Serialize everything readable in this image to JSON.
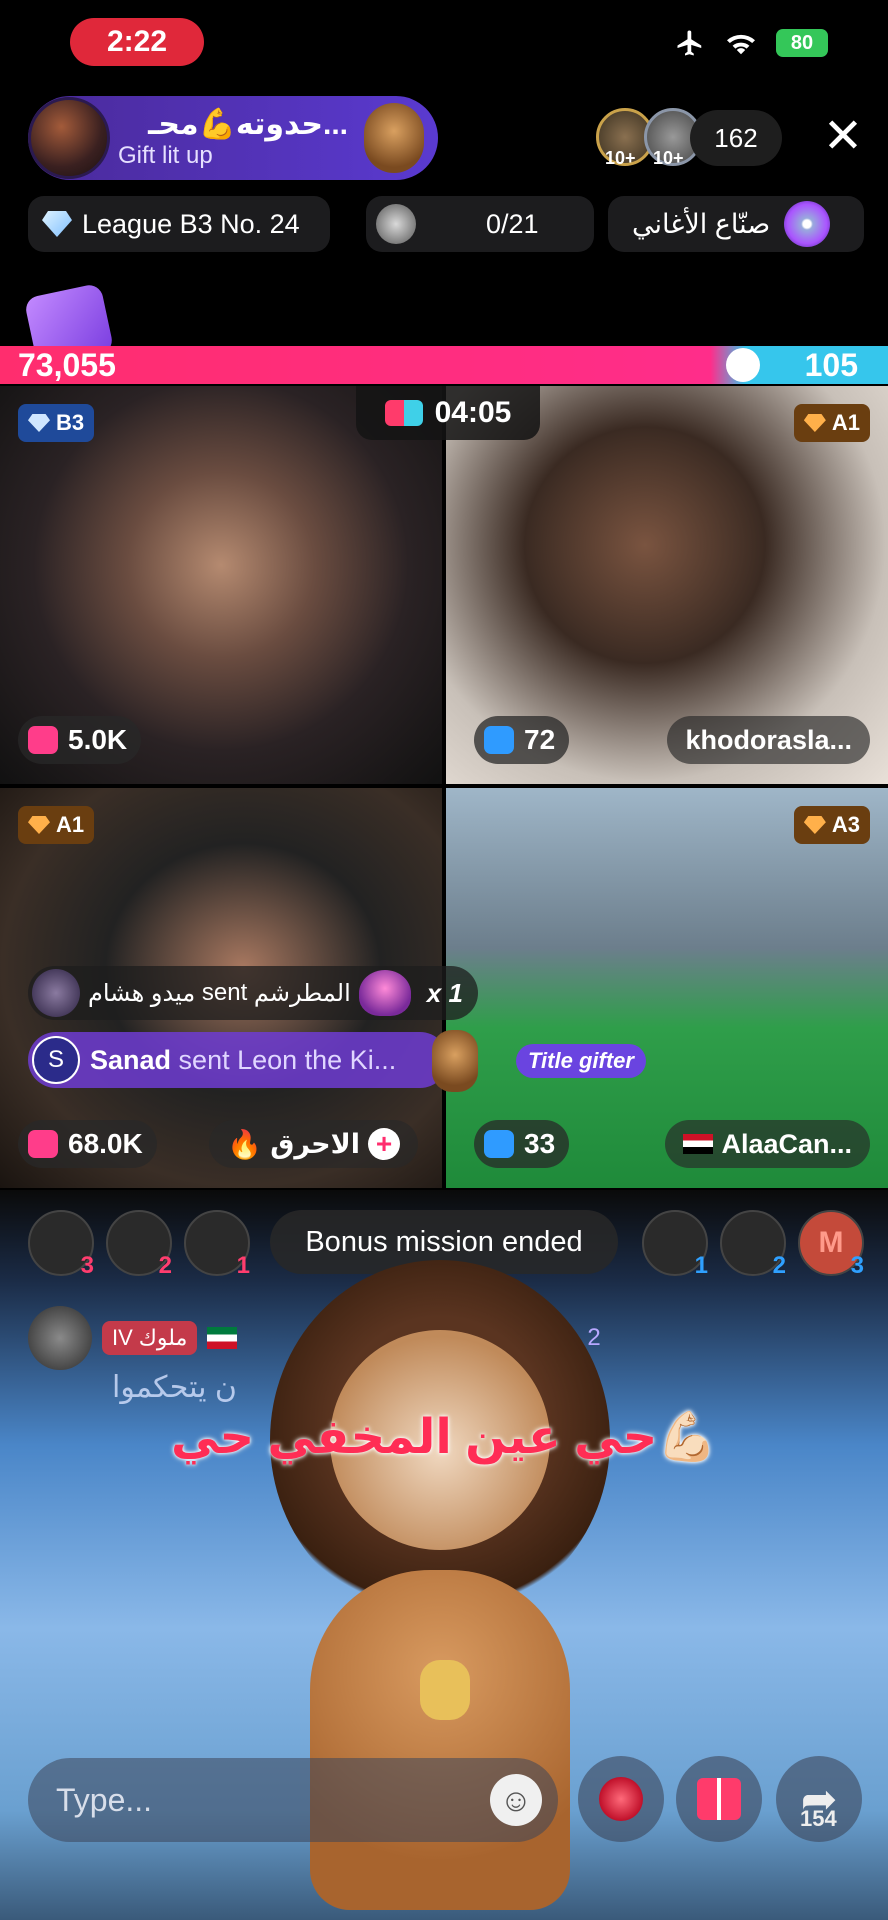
{
  "status": {
    "time": "2:22",
    "battery": "80",
    "icons": [
      "airplane-icon",
      "wifi-icon"
    ]
  },
  "host": {
    "name": "حدوته💪محـ...",
    "subtitle": "Gift lit up"
  },
  "viewers": {
    "badge1": "10+",
    "badge2": "10+",
    "count": "162"
  },
  "chips": {
    "league": "League B3 No. 24",
    "goat_count": "0/21",
    "songs": "صنّاع الأغاني"
  },
  "battle": {
    "left_score": "73,055",
    "right_score": "105",
    "timer": "04:05"
  },
  "tiles": [
    {
      "rank": "B3",
      "stat": "5.0K"
    },
    {
      "rank": "A1",
      "stat": "72",
      "name": "khodorasla..."
    },
    {
      "rank": "A1",
      "stat": "68.0K",
      "name": "الاحرق"
    },
    {
      "rank": "A3",
      "stat": "33",
      "name": "AlaaCan..."
    }
  ],
  "gifts": {
    "row1": {
      "sender": "ميدو هشام",
      "verb": "sent",
      "target": "المطرشم",
      "multiplier": "x 1"
    },
    "row2": {
      "avatar_letter": "S",
      "sender": "Sanad",
      "text": "sent Leon the Ki..."
    },
    "title_gifter": "Title gifter"
  },
  "leaderboard": {
    "left": [
      "3",
      "2",
      "1"
    ],
    "right": [
      "1",
      "2",
      "3"
    ],
    "right_letter": "M",
    "bonus": "Bonus mission ended"
  },
  "comment": {
    "level": "IV",
    "user": "ملوك",
    "text": "ن يتحكموا",
    "count": "2"
  },
  "caption": "حي عين المخفي حي💪🏻",
  "bottom": {
    "placeholder": "Type...",
    "share_count": "154"
  },
  "colors": {
    "accent_pink": "#ff2d6e",
    "accent_blue": "#36c6ec",
    "time_pill": "#e0283a",
    "gifter_purple": "#6a44e0"
  }
}
